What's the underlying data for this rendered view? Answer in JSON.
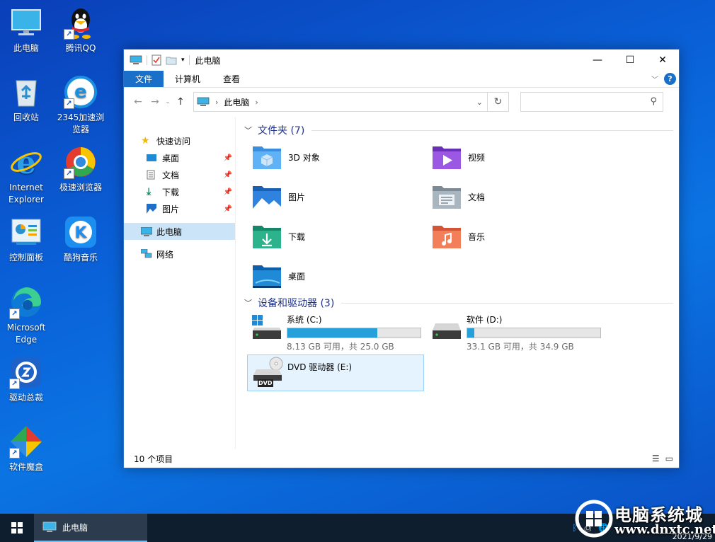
{
  "desktop": {
    "icons": [
      {
        "label": "此电脑",
        "icon": "computer-icon"
      },
      {
        "label": "腾讯QQ",
        "icon": "qq-penguin-icon"
      },
      {
        "label": "回收站",
        "icon": "recycle-bin-icon"
      },
      {
        "label": "2345加速浏览器",
        "icon": "browser-2345-icon"
      },
      {
        "label": "Internet Explorer",
        "icon": "internet-explorer-icon"
      },
      {
        "label": "极速浏览器",
        "icon": "speed-browser-icon"
      },
      {
        "label": "控制面板",
        "icon": "control-panel-icon"
      },
      {
        "label": "酷狗音乐",
        "icon": "kugou-music-icon"
      },
      {
        "label": "Microsoft Edge",
        "icon": "edge-icon"
      },
      {
        "label": "驱动总裁",
        "icon": "driver-tool-icon"
      },
      {
        "label": "软件魔盒",
        "icon": "software-box-icon"
      }
    ]
  },
  "window": {
    "title": "此电脑",
    "controls": {
      "minimize": "—",
      "maximize": "☐",
      "close": "✕"
    },
    "ribbon_tabs": [
      "文件",
      "计算机",
      "查看"
    ],
    "address": {
      "crumb": "此电脑"
    },
    "search": {
      "placeholder": ""
    },
    "nav": {
      "quick_access": "快速访问",
      "pinned": [
        "桌面",
        "文档",
        "下载",
        "图片"
      ],
      "this_pc": "此电脑",
      "network": "网络"
    },
    "folders_header": "文件夹 (7)",
    "folders": [
      "3D 对象",
      "视频",
      "图片",
      "文档",
      "下载",
      "音乐",
      "桌面"
    ],
    "drives_header": "设备和驱动器 (3)",
    "drives": [
      {
        "label": "系统 (C:)",
        "free": "8.13 GB 可用，共 25.0 GB",
        "used_pct": 67.5,
        "icon": "windows-drive-icon"
      },
      {
        "label": "软件 (D:)",
        "free": "33.1 GB 可用，共 34.9 GB",
        "used_pct": 5.2,
        "icon": "hard-drive-icon"
      },
      {
        "label": "DVD 驱动器 (E:)",
        "icon": "dvd-drive-icon",
        "badge": "DVD"
      }
    ],
    "status": "10 个项目"
  },
  "taskbar": {
    "task_label": "此电脑",
    "clock_date": "2021/9/29"
  },
  "watermark": {
    "line1": "电脑系统城",
    "line2": "www.dnxtc.net"
  },
  "colors": {
    "accent": "#1a6fc8",
    "bar_fill": "#26a0da",
    "header_text": "#1e3287"
  }
}
